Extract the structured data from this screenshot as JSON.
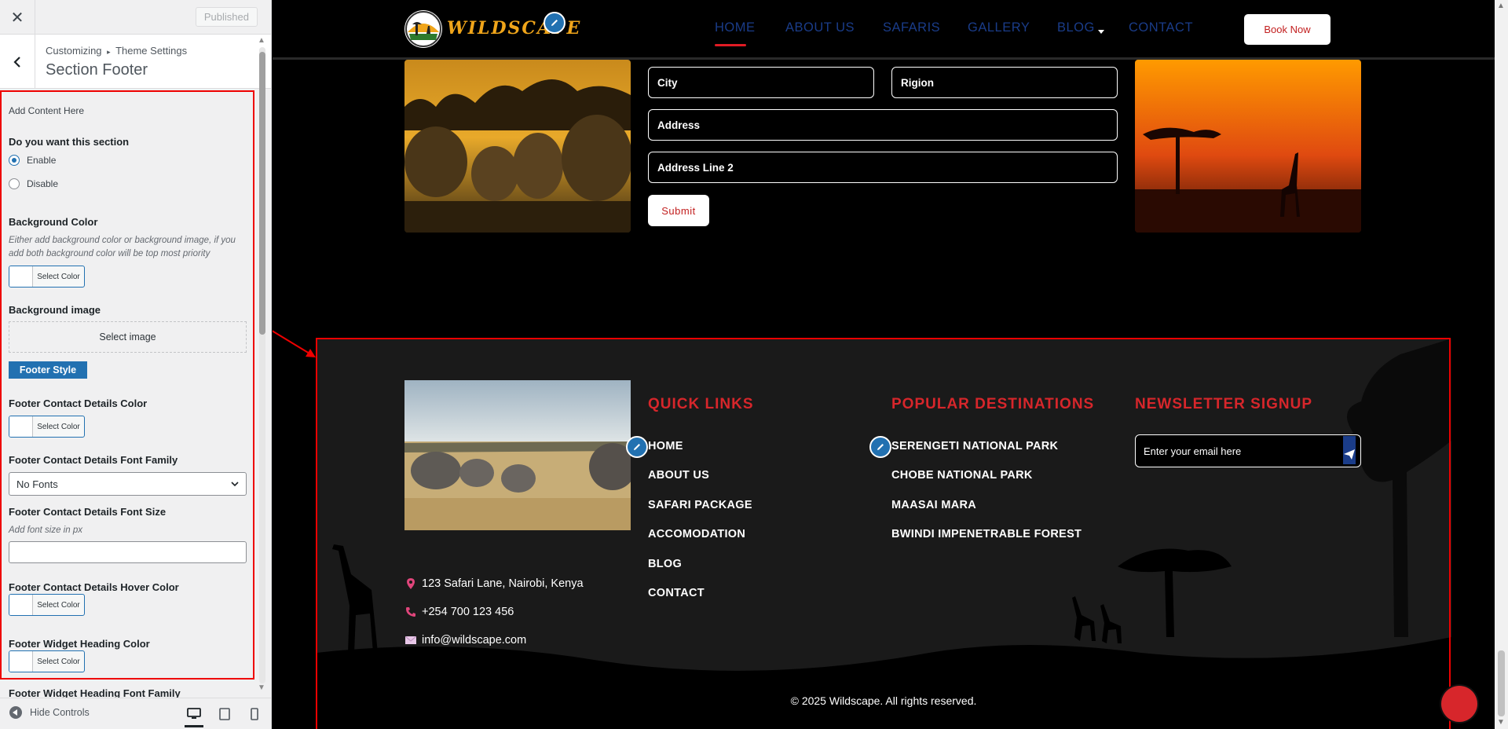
{
  "sidebar": {
    "close_icon": "close-icon",
    "published": "Published",
    "breadcrumb": {
      "root": "Customizing",
      "sep": "▸",
      "current": "Theme Settings"
    },
    "section_title": "Section Footer",
    "add_content": "Add Content Here",
    "want_section": "Do you want this section",
    "enable": "Enable",
    "disable": "Disable",
    "enable_selected": true,
    "bg_color_label": "Background Color",
    "bg_color_desc": "Either add background color or background image, if you add both background color will be top most priority",
    "select_color": "Select Color",
    "bg_image_label": "Background image",
    "select_image": "Select image",
    "footer_style": "Footer Style",
    "contact_color_label": "Footer Contact Details Color",
    "contact_font_family_label": "Footer Contact Details Font Family",
    "font_family_value": "No Fonts",
    "contact_font_size_label": "Footer Contact Details Font Size",
    "font_size_desc": "Add font size in px",
    "font_size_value": "",
    "contact_hover_label": "Footer Contact Details Hover Color",
    "widget_heading_color_label": "Footer Widget Heading Color",
    "widget_heading_font_label": "Footer Widget Heading Font Family",
    "hide_controls": "Hide Controls"
  },
  "header": {
    "brand": "WILDSCAPE",
    "nav": [
      {
        "label": "HOME",
        "active": true
      },
      {
        "label": "ABOUT US"
      },
      {
        "label": "SAFARIS"
      },
      {
        "label": "GALLERY"
      },
      {
        "label": "BLOG",
        "has_dropdown": true
      },
      {
        "label": "CONTACT"
      }
    ],
    "book_now": "Book Now"
  },
  "form": {
    "city": "City",
    "region": "Rigion",
    "address": "Address",
    "address2": "Address Line 2",
    "submit": "Submit"
  },
  "footer": {
    "contact": {
      "address": "123 Safari Lane, Nairobi, Kenya",
      "phone": "+254 700 123 456",
      "email": "info@wildscape.com"
    },
    "quick_links_title": "QUICK LINKS",
    "quick_links": [
      "HOME",
      "ABOUT US",
      "SAFARI PACKAGE",
      "ACCOMODATION",
      "BLOG",
      "CONTACT"
    ],
    "destinations_title": "POPULAR DESTINATIONS",
    "destinations": [
      "SERENGETI NATIONAL PARK",
      "CHOBE NATIONAL PARK",
      "MAASAI MARA",
      "BWINDI IMPENETRABLE FOREST"
    ],
    "newsletter_title": "NEWSLETTER SIGNUP",
    "newsletter_placeholder": "Enter your email here",
    "copyright": "© 2025 Wildscape. All rights reserved."
  },
  "colors": {
    "accent_red": "#d7262b",
    "nav_blue": "#1a3c89",
    "wp_blue": "#2271b1",
    "brand_orange": "#f0a51a"
  }
}
